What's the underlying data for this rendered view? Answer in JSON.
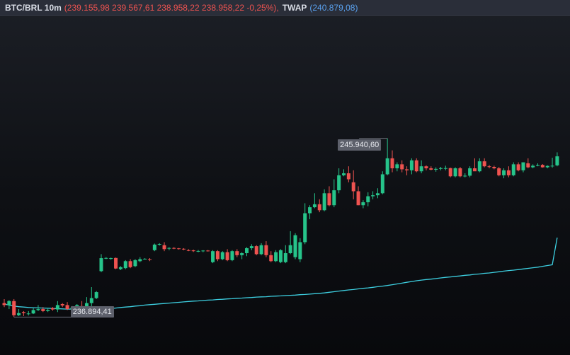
{
  "header": {
    "symbol": "BTC/BRL 10m",
    "ohlc": "(239.155,98 239.567,61 238.958,22 238.958,22 -0,25%),",
    "twap_label": "TWAP",
    "twap_value": "(240.879,08)"
  },
  "colors": {
    "up": "#26c48a",
    "down": "#ef5350",
    "twap": "#3dcfe0",
    "label_bg": "#5d606b"
  },
  "chart_data": {
    "type": "candlestick",
    "ylim": [
      235000,
      252000
    ],
    "grid": false,
    "high_label": "245.940,60",
    "low_label": "236.894,41",
    "candles": [
      [
        237600,
        237800,
        237400,
        237500
      ],
      [
        237500,
        237750,
        237300,
        237700
      ],
      [
        237700,
        237800,
        236900,
        236990
      ],
      [
        236990,
        237300,
        236950,
        237100
      ],
      [
        237150,
        237200,
        236950,
        237100
      ],
      [
        237050,
        237200,
        236980,
        237080
      ],
      [
        237080,
        237350,
        237050,
        237250
      ],
      [
        237250,
        237500,
        237200,
        237300
      ],
      [
        237300,
        237400,
        237150,
        237200
      ],
      [
        237200,
        237350,
        237150,
        237250
      ],
      [
        237350,
        237400,
        237220,
        237280
      ],
      [
        237280,
        237700,
        237150,
        237500
      ],
      [
        237550,
        237600,
        237400,
        237480
      ],
      [
        237500,
        237650,
        237250,
        237300
      ],
      [
        237280,
        237450,
        237150,
        237370
      ],
      [
        237370,
        237550,
        237350,
        237500
      ],
      [
        237450,
        237700,
        237300,
        237350
      ],
      [
        237250,
        237900,
        237250,
        237600
      ],
      [
        237600,
        238400,
        237400,
        237850
      ],
      [
        237850,
        238200,
        237800,
        238150
      ],
      [
        239200,
        240050,
        239150,
        239850
      ],
      [
        239850,
        239900,
        239800,
        239860
      ],
      [
        239830,
        239880,
        239770,
        239850
      ],
      [
        239860,
        239880,
        239300,
        239330
      ],
      [
        239300,
        239450,
        239250,
        239400
      ],
      [
        239350,
        239750,
        239300,
        239700
      ],
      [
        239700,
        239800,
        239350,
        239400
      ],
      [
        239450,
        239800,
        239400,
        239750
      ],
      [
        239700,
        239900,
        239650,
        239800
      ],
      [
        239800,
        239850,
        239780,
        239820
      ],
      [
        239800,
        239850,
        239700,
        239780
      ],
      [
        240250,
        240580,
        240200,
        240530
      ],
      [
        240530,
        240600,
        240480,
        240560
      ],
      [
        240500,
        240650,
        240200,
        240300
      ],
      [
        240350,
        240400,
        240250,
        240360
      ],
      [
        240360,
        240400,
        240300,
        240340
      ],
      [
        240340,
        240360,
        240280,
        240320
      ],
      [
        240320,
        240350,
        240250,
        240300
      ],
      [
        240250,
        240300,
        240200,
        240240
      ],
      [
        240240,
        240280,
        240160,
        240200
      ],
      [
        240200,
        240260,
        240150,
        240210
      ],
      [
        240210,
        240250,
        240150,
        240230
      ],
      [
        240230,
        240260,
        240180,
        240210
      ],
      [
        239650,
        240250,
        239600,
        240200
      ],
      [
        240200,
        240250,
        239700,
        239800
      ],
      [
        239800,
        240200,
        239750,
        240150
      ],
      [
        240150,
        240300,
        239700,
        239750
      ],
      [
        239750,
        240250,
        239700,
        240200
      ],
      [
        240200,
        240300,
        239900,
        240000
      ],
      [
        240000,
        240150,
        239800,
        240100
      ],
      [
        240100,
        240400,
        239950,
        240350
      ],
      [
        240350,
        240550,
        240250,
        240450
      ],
      [
        240450,
        240500,
        240000,
        240050
      ],
      [
        240050,
        240600,
        240000,
        240500
      ],
      [
        240500,
        240700,
        239900,
        240000
      ],
      [
        240000,
        240200,
        239650,
        239700
      ],
      [
        239700,
        240250,
        239650,
        240150
      ],
      [
        239650,
        240300,
        239600,
        240250
      ],
      [
        239650,
        240500,
        239600,
        240100
      ],
      [
        240100,
        241200,
        240050,
        240500
      ],
      [
        239900,
        241100,
        239800,
        241000
      ],
      [
        239800,
        240850,
        239650,
        240650
      ],
      [
        240650,
        242600,
        240550,
        242100
      ],
      [
        242100,
        242500,
        241800,
        242400
      ],
      [
        242400,
        243100,
        242350,
        242550
      ],
      [
        242550,
        242800,
        242150,
        242250
      ],
      [
        242250,
        243300,
        242200,
        243100
      ],
      [
        243100,
        243450,
        242450,
        242500
      ],
      [
        242500,
        243800,
        242400,
        243250
      ],
      [
        243250,
        244350,
        243100,
        244000
      ],
      [
        244000,
        244300,
        243950,
        244100
      ],
      [
        244100,
        244450,
        243650,
        243800
      ],
      [
        243650,
        244250,
        242800,
        243200
      ],
      [
        243200,
        243450,
        242500,
        242500
      ],
      [
        242500,
        242750,
        242350,
        242650
      ],
      [
        242650,
        243150,
        242450,
        242950
      ],
      [
        242950,
        243200,
        242800,
        243000
      ],
      [
        243000,
        243350,
        242850,
        243100
      ],
      [
        243100,
        244200,
        243050,
        244050
      ],
      [
        244050,
        245850,
        244000,
        244850
      ],
      [
        244850,
        245250,
        244150,
        244350
      ],
      [
        244350,
        244650,
        244200,
        244550
      ],
      [
        244550,
        244750,
        244150,
        244300
      ],
      [
        244300,
        244450,
        244000,
        244250
      ],
      [
        244250,
        244850,
        244050,
        244750
      ],
      [
        244750,
        244850,
        244150,
        244200
      ],
      [
        244200,
        244750,
        244100,
        244450
      ],
      [
        244450,
        244500,
        244250,
        244350
      ],
      [
        244350,
        244450,
        244250,
        244280
      ],
      [
        244280,
        244400,
        244180,
        244320
      ],
      [
        244320,
        244420,
        244250,
        244360
      ],
      [
        244360,
        244480,
        244250,
        244360
      ],
      [
        244360,
        244380,
        243900,
        243950
      ],
      [
        243950,
        244400,
        243900,
        244350
      ],
      [
        244350,
        244420,
        243900,
        243950
      ],
      [
        243950,
        244100,
        243900,
        243980
      ],
      [
        243980,
        244450,
        243900,
        244350
      ],
      [
        244350,
        244850,
        244250,
        244200
      ],
      [
        244200,
        244850,
        244150,
        244700
      ],
      [
        244700,
        244850,
        244400,
        244450
      ],
      [
        244450,
        244520,
        244350,
        244420
      ],
      [
        244420,
        244480,
        244300,
        244350
      ],
      [
        244350,
        244420,
        243950,
        244000
      ],
      [
        244000,
        244350,
        243850,
        244250
      ],
      [
        244250,
        244450,
        243900,
        244000
      ],
      [
        244000,
        244650,
        243950,
        244550
      ],
      [
        244550,
        244650,
        244200,
        244250
      ],
      [
        244250,
        244650,
        244150,
        244650
      ],
      [
        244600,
        244850,
        244350,
        244400
      ],
      [
        244400,
        244550,
        244350,
        244480
      ],
      [
        244480,
        244600,
        244450,
        244520
      ],
      [
        244520,
        244560,
        244380,
        244400
      ],
      [
        244400,
        244500,
        244350,
        244470
      ],
      [
        244470,
        244880,
        244380,
        244480
      ],
      [
        244500,
        245150,
        244450,
        244950
      ]
    ],
    "twap": [
      237550,
      237500,
      237450,
      237420,
      237400,
      237380,
      237370,
      237360,
      237350,
      237340,
      237330,
      237320,
      237310,
      237300,
      237300,
      237290,
      237280,
      237280,
      237270,
      237260,
      237270,
      237290,
      237320,
      237350,
      237380,
      237400,
      237420,
      237450,
      237470,
      237500,
      237520,
      237540,
      237560,
      237580,
      237600,
      237620,
      237640,
      237660,
      237680,
      237700,
      237710,
      237730,
      237750,
      237760,
      237780,
      237790,
      237810,
      237820,
      237840,
      237850,
      237870,
      237880,
      237900,
      237910,
      237920,
      237940,
      237950,
      237960,
      237980,
      237990,
      238000,
      238020,
      238030,
      238050,
      238070,
      238090,
      238110,
      238140,
      238170,
      238200,
      238230,
      238260,
      238280,
      238310,
      238340,
      238360,
      238390,
      238420,
      238450,
      238480,
      238520,
      238560,
      238600,
      238640,
      238680,
      238720,
      238750,
      238780,
      238800,
      238830,
      238860,
      238890,
      238910,
      238940,
      238960,
      238990,
      239010,
      239040,
      239060,
      239090,
      239110,
      239140,
      239170,
      239200,
      239230,
      239250,
      239280,
      239310,
      239340,
      239370,
      239400,
      239440,
      239480,
      239520,
      240879
    ]
  }
}
